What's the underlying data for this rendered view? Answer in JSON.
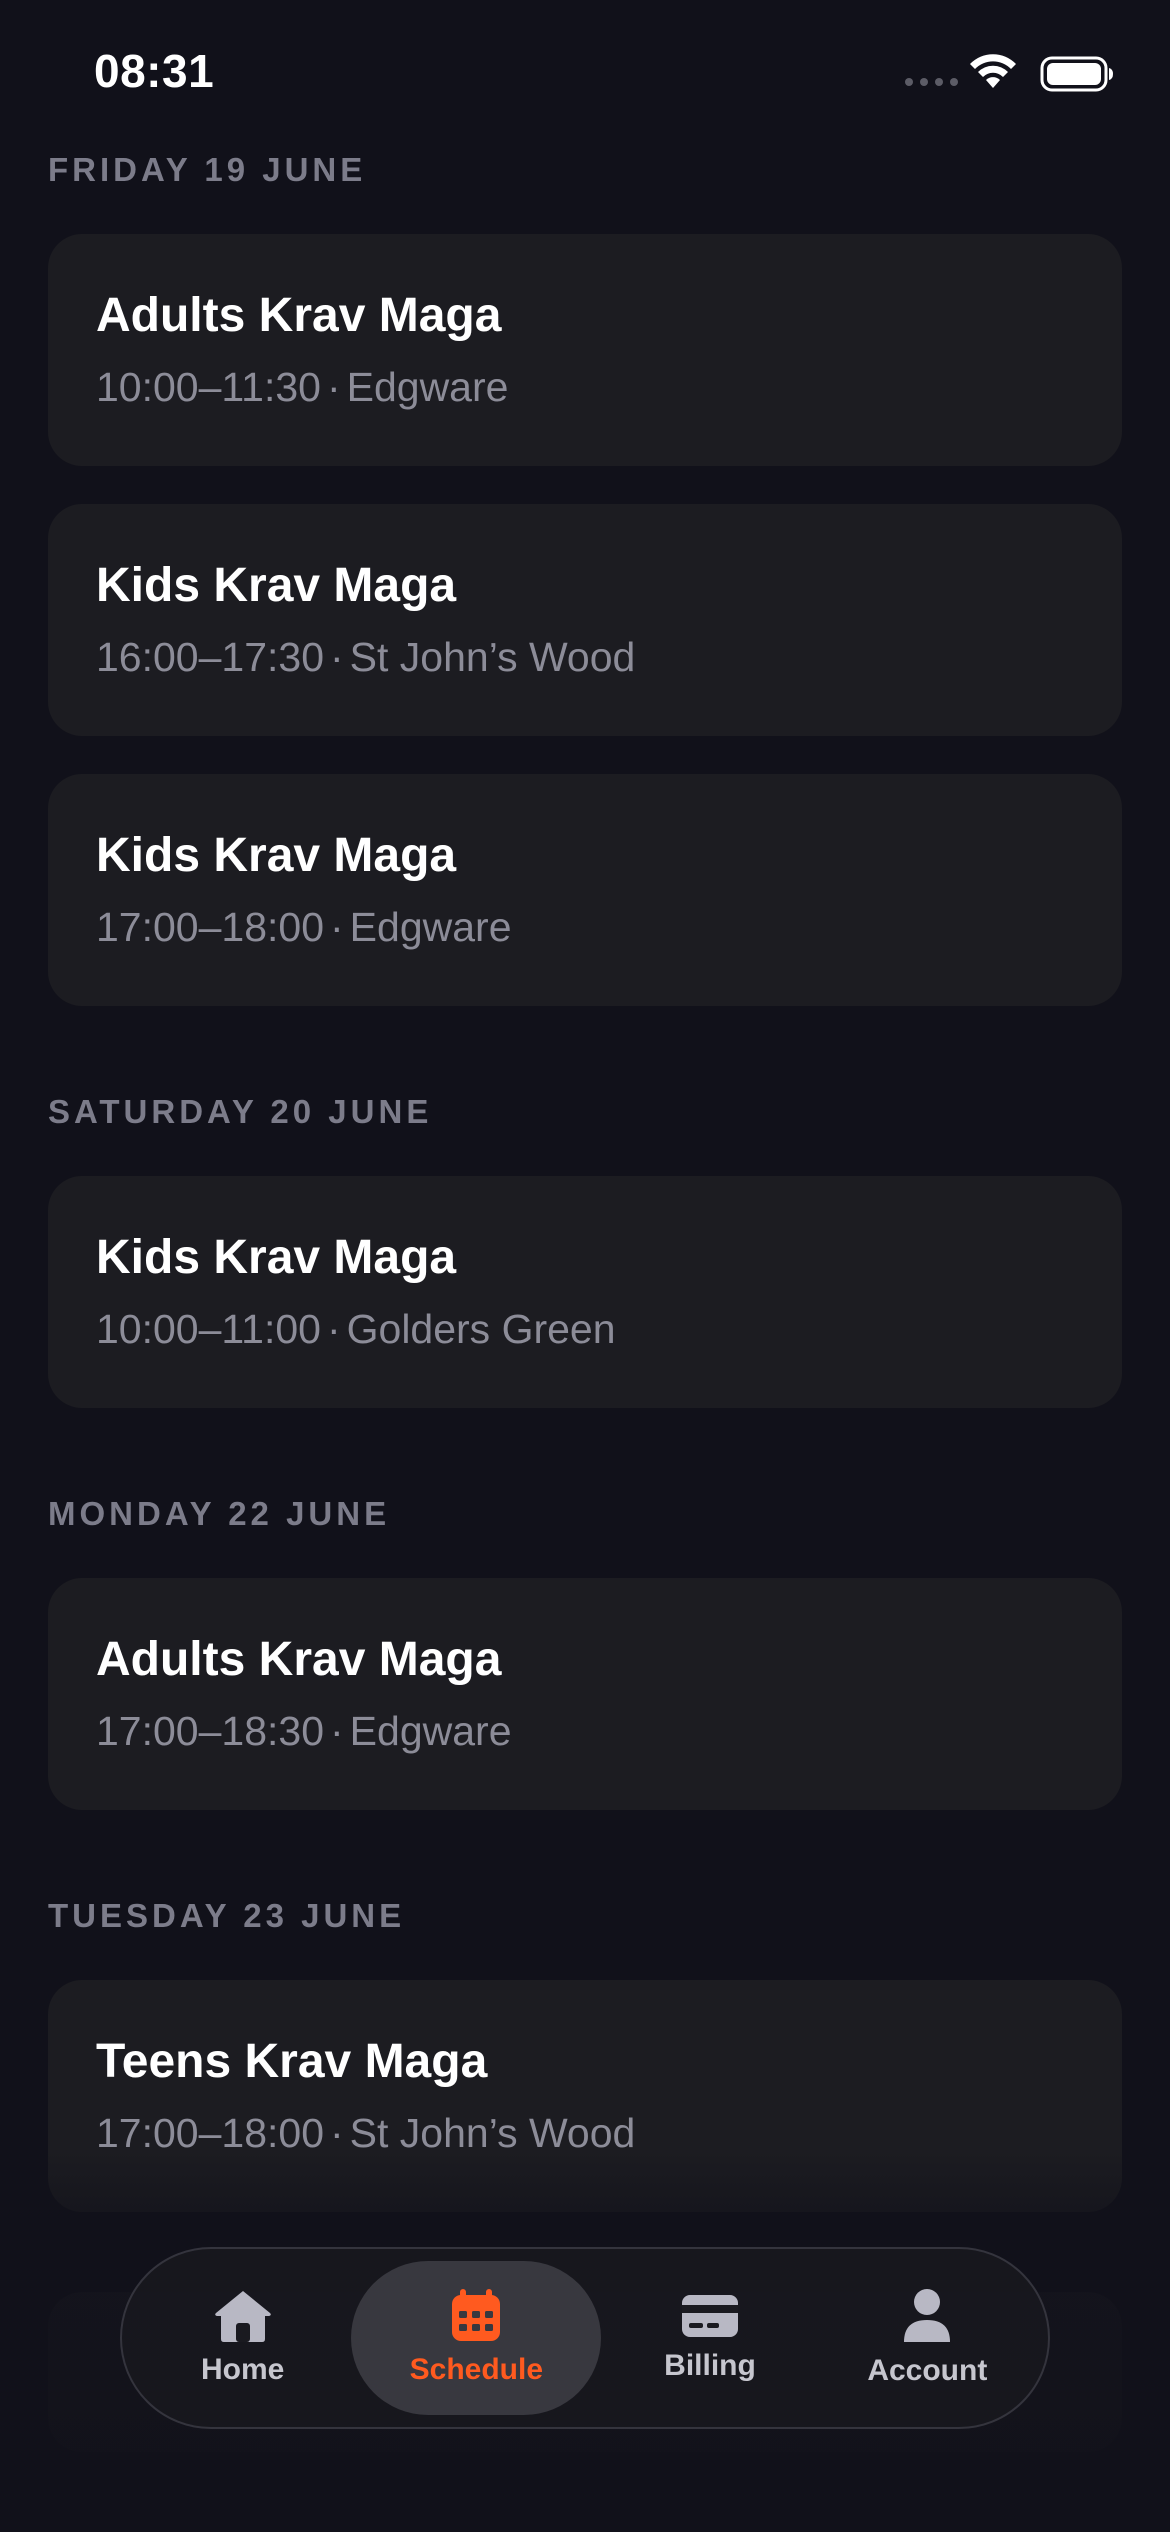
{
  "status_bar": {
    "time": "08:31"
  },
  "colors": {
    "accent": "#ff5a1f",
    "background": "#11111a",
    "card": "#1c1c21",
    "muted_text": "#8c8c98"
  },
  "schedule": {
    "days": [
      {
        "label": "FRIDAY 19 JUNE",
        "classes": [
          {
            "title": "Adults Krav Maga",
            "time": "10:00–11:30",
            "location": "Edgware"
          },
          {
            "title": "Kids Krav Maga",
            "time": "16:00–17:30",
            "location": "St John’s Wood"
          },
          {
            "title": "Kids Krav Maga",
            "time": "17:00–18:00",
            "location": "Edgware"
          }
        ]
      },
      {
        "label": "SATURDAY 20 JUNE",
        "classes": [
          {
            "title": "Kids Krav Maga",
            "time": "10:00–11:00",
            "location": "Golders Green"
          }
        ]
      },
      {
        "label": "MONDAY 22 JUNE",
        "classes": [
          {
            "title": "Adults Krav Maga",
            "time": "17:00–18:30",
            "location": "Edgware"
          }
        ]
      },
      {
        "label": "TUESDAY 23 JUNE",
        "classes": [
          {
            "title": "Teens Krav Maga",
            "time": "17:00–18:00",
            "location": "St John’s Wood"
          }
        ]
      }
    ],
    "separator": "·"
  },
  "tab_bar": {
    "tabs": [
      {
        "label": "Home",
        "icon": "home-icon",
        "active": false
      },
      {
        "label": "Schedule",
        "icon": "calendar-icon",
        "active": true
      },
      {
        "label": "Billing",
        "icon": "credit-card-icon",
        "active": false
      },
      {
        "label": "Account",
        "icon": "person-icon",
        "active": false
      }
    ]
  }
}
